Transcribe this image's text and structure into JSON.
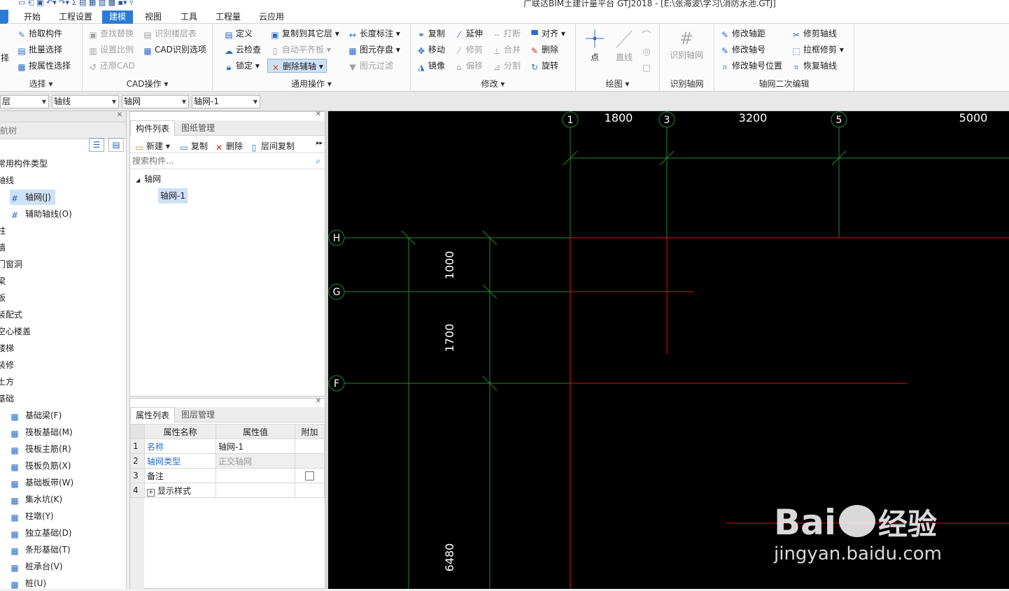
{
  "window": {
    "title": "广联达BIM土建计量平台 GTJ2018 - [E:\\张海波\\学习\\消防水池.GTJ]"
  },
  "menu": {
    "tabs": [
      "开始",
      "工程设置",
      "建模",
      "视图",
      "工具",
      "工程量",
      "云应用"
    ],
    "active": "建模"
  },
  "ribbon": {
    "select_group": {
      "label": "选择",
      "partial_big": "择",
      "items": [
        "拾取构件",
        "批量选择",
        "按属性选择"
      ]
    },
    "cad_group": {
      "label": "CAD操作",
      "items": [
        "查找替换",
        "识别楼层表",
        "设置比例",
        "CAD识别选项",
        "还原CAD"
      ]
    },
    "common_group": {
      "label": "通用操作",
      "items": [
        "定义",
        "复制到其它层",
        "长度标注",
        "云检查",
        "自动平齐板",
        "图元存盘",
        "锁定",
        "删除辅轴",
        "图元过滤"
      ]
    },
    "modify_group": {
      "label": "修改",
      "items": [
        "复制",
        "延伸",
        "打断",
        "对齐",
        "移动",
        "修剪",
        "合并",
        "删除",
        "镜像",
        "偏移",
        "分割",
        "旋转"
      ]
    },
    "draw_group": {
      "label": "绘图",
      "items": [
        "点",
        "直线"
      ]
    },
    "identify_group": {
      "label": "识别轴网",
      "items": [
        "识别轴网"
      ]
    },
    "axis_edit_group": {
      "label": "轴网二次编辑",
      "items": [
        "修改轴距",
        "修剪轴线",
        "修改轴号",
        "拉框修剪",
        "修改轴号位置",
        "恢复轴线"
      ]
    }
  },
  "selectors": [
    "层",
    "轴线",
    "轴网",
    "轴网-1"
  ],
  "left_tree": {
    "header": "航树",
    "items": [
      "常用构件类型",
      "轴线",
      "轴网(J)",
      "辅助轴线(O)",
      "柱",
      "墙",
      "门窗洞",
      "梁",
      "板",
      "装配式",
      "空心楼盖",
      "楼梯",
      "装修",
      "土方",
      "基础",
      "基础梁(F)",
      "筏板基础(M)",
      "筏板主筋(R)",
      "筏板负筋(X)",
      "基础板带(W)",
      "集水坑(K)",
      "柱墩(Y)",
      "独立基础(D)",
      "条形基础(T)",
      "桩承台(V)",
      "桩(U)"
    ]
  },
  "component_list": {
    "tabs": [
      "构件列表",
      "图纸管理"
    ],
    "toolbar": [
      "新建",
      "复制",
      "删除",
      "层间复制"
    ],
    "search_placeholder": "搜索构件...",
    "group": "轴网",
    "item": "轴网-1"
  },
  "properties": {
    "tabs": [
      "属性列表",
      "图层管理"
    ],
    "headers": [
      "属性名称",
      "属性值",
      "附加"
    ],
    "rows": [
      {
        "no": "1",
        "name": "名称",
        "value": "轴网-1"
      },
      {
        "no": "2",
        "name": "轴网类型",
        "value": "正交轴网"
      },
      {
        "no": "3",
        "name": "备注",
        "value": ""
      },
      {
        "no": "4",
        "name": "显示样式",
        "value": ""
      }
    ]
  },
  "canvas": {
    "top_axes": [
      "1",
      "3",
      "5"
    ],
    "top_dims": [
      "1800",
      "3200",
      "5000"
    ],
    "left_axes": [
      "H",
      "G",
      "F"
    ],
    "left_dims": [
      "1000",
      "1700",
      "6480"
    ],
    "line_color_green": "#1f8a2e",
    "line_color_red": "#e01010"
  },
  "watermark": {
    "brand": "Bai",
    "brand2": "经验",
    "url": "jingyan.baidu.com"
  }
}
